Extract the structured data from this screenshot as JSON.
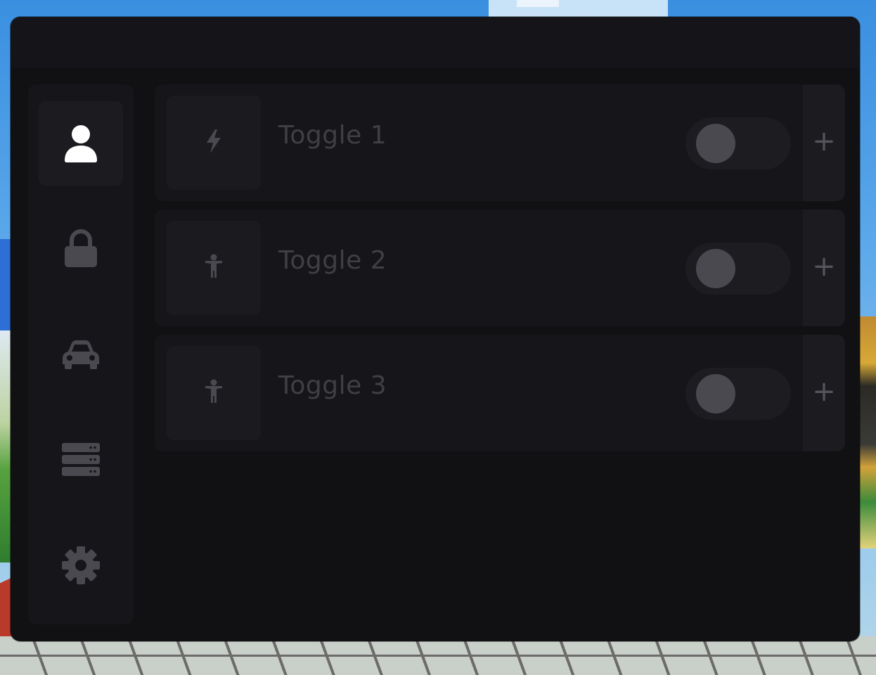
{
  "panel": {
    "title": ""
  },
  "sidebar": {
    "items": [
      {
        "icon": "user-icon",
        "active": true
      },
      {
        "icon": "lock-icon",
        "active": false
      },
      {
        "icon": "car-icon",
        "active": false
      },
      {
        "icon": "server-icon",
        "active": false
      },
      {
        "icon": "gear-icon",
        "active": false
      }
    ]
  },
  "toggles": [
    {
      "label": "Toggle 1",
      "icon": "bolt-icon",
      "enabled": false,
      "add_label": "+"
    },
    {
      "label": "Toggle 2",
      "icon": "person-icon",
      "enabled": false,
      "add_label": "+"
    },
    {
      "label": "Toggle 3",
      "icon": "person-icon",
      "enabled": false,
      "add_label": "+"
    }
  ],
  "colors": {
    "panel_bg": "#111114",
    "row_bg": "#16161a",
    "knob": "#4a494f",
    "active_icon": "#ffffff",
    "inactive_icon": "#4a494f"
  }
}
